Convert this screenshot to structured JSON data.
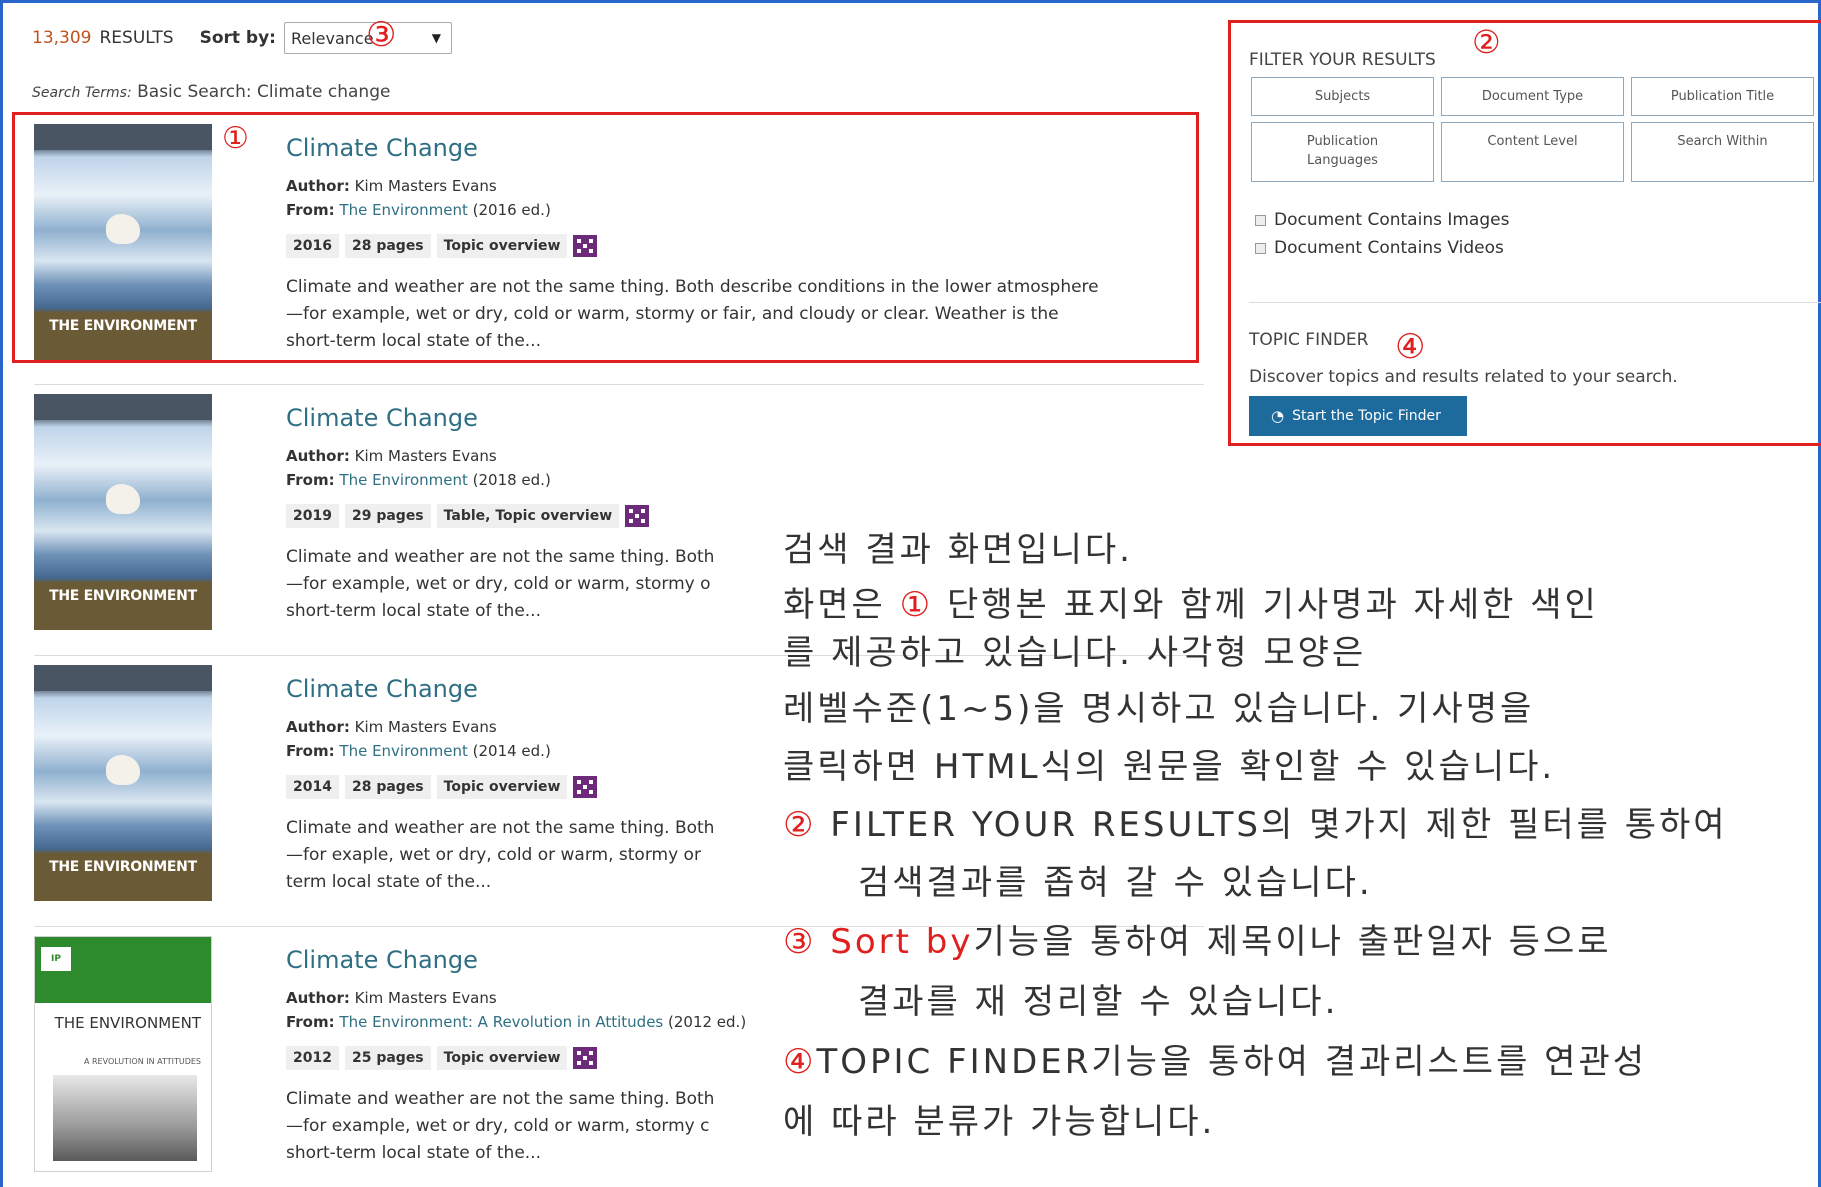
{
  "header": {
    "count": "13,309",
    "results_label": "RESULTS",
    "sort_label": "Sort by:",
    "sort_value": "Relevance",
    "search_terms_label": "Search Terms:",
    "search_terms_value": "Basic Search: Climate change"
  },
  "results": [
    {
      "title": "Climate Change",
      "author_label": "Author:",
      "author": "Kim Masters Evans",
      "from_label": "From:",
      "source": "The Environment",
      "edition": "(2016 ed.)",
      "tags": [
        "2016",
        "28 pages",
        "Topic overview"
      ],
      "snippet": [
        "Climate and weather are not the same thing. Both describe conditions in the lower atmosphere",
        "—for example, wet or dry, cold or warm, stormy or fair, and cloudy or clear. Weather is the",
        "short-term local state of the..."
      ],
      "cover_title": "THE ENVIRONMENT"
    },
    {
      "title": "Climate Change",
      "author_label": "Author:",
      "author": "Kim Masters Evans",
      "from_label": "From:",
      "source": "The Environment",
      "edition": "(2018 ed.)",
      "tags": [
        "2019",
        "29 pages",
        "Table, Topic overview"
      ],
      "snippet": [
        "Climate and weather are not the same thing. Both",
        "—for example, wet or dry, cold or warm, stormy o",
        "short-term local state of the..."
      ],
      "cover_title": "THE ENVIRONMENT"
    },
    {
      "title": "Climate Change",
      "author_label": "Author:",
      "author": "Kim Masters Evans",
      "from_label": "From:",
      "source": "The Environment",
      "edition": "(2014 ed.)",
      "tags": [
        "2014",
        "28 pages",
        "Topic overview"
      ],
      "snippet": [
        "Climate and weather are not the same thing. Both",
        "—for exaple, wet or dry, cold or warm, stormy or",
        "term local state of the..."
      ],
      "cover_title": "THE ENVIRONMENT"
    },
    {
      "title": "Climate Change",
      "author_label": "Author:",
      "author": "Kim Masters Evans",
      "from_label": "From:",
      "source": "The Environment: A Revolution in Attitudes",
      "edition": "(2012 ed.)",
      "tags": [
        "2012",
        "25 pages",
        "Topic overview"
      ],
      "snippet": [
        "Climate and weather are not the same thing. Both",
        "—for example, wet or dry, cold or warm, stormy c",
        "short-term local state of the..."
      ],
      "cover_title": "THE ENVIRONMENT",
      "cover_subtitle": "A REVOLUTION IN ATTITUDES"
    }
  ],
  "filter": {
    "title": "FILTER YOUR RESULTS",
    "buttons": [
      "Subjects",
      "Document Type",
      "Publication Title",
      "Publication Languages",
      "Content Level",
      "Search Within"
    ],
    "checkboxes": [
      "Document Contains Images",
      "Document Contains Videos"
    ]
  },
  "topic_finder": {
    "title": "TOPIC FINDER",
    "description": "Discover topics and results related to your search.",
    "button": "Start the Topic Finder"
  },
  "markers": [
    "①",
    "②",
    "③",
    "④"
  ],
  "annotation": {
    "line1": "검색 결과 화면입니다.",
    "line2_a": "화면은",
    "line2_b": "단행본 표지와 함께 기사명과 자세한 색인",
    "line3": "를 제공하고 있습니다. 사각형 모양은",
    "line4": "레벨수준(1~5)을 명시하고 있습니다. 기사명을",
    "line5": "클릭하면 HTML식의 원문을 확인할 수 있습니다.",
    "line6": "FILTER YOUR RESULTS의 몇가지 제한 필터를 통하여",
    "line7": "검색결과를 좁혀 갈 수 있습니다.",
    "line8_a": "Sort by",
    "line8_b": "기능을 통하여 제목이나 출판일자 등으로",
    "line9": "결과를 재 정리할 수 있습니다.",
    "line10": "TOPIC FINDER기능을 통하여 결과리스트를 연관성",
    "line11": "에 따라 분류가 가능합니다."
  },
  "colors": {
    "frame": "#2a66c9",
    "highlight": "#e0201e",
    "link": "#2f6f84",
    "count": "#c0521f",
    "button": "#1d6b9c",
    "level_icon": "#6d2a7a"
  }
}
